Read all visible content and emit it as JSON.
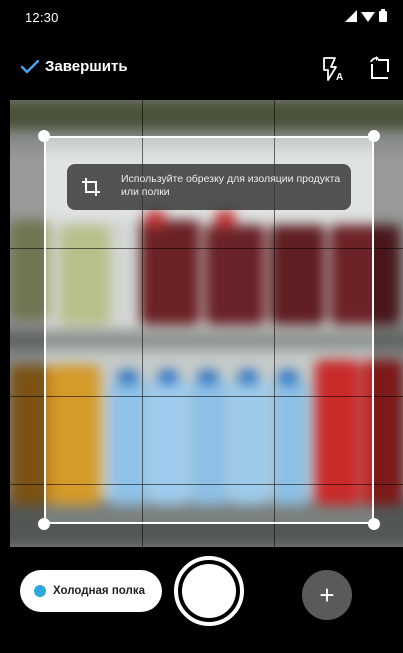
{
  "status_bar": {
    "time": "12:30",
    "icons": [
      "signal-icon",
      "wifi-icon",
      "battery-icon"
    ]
  },
  "toolbar": {
    "done_label": "Завершить",
    "done_icon": "checkmark-icon",
    "flash_icon": "flash-auto-icon",
    "rotate_icon": "rotate-crop-icon",
    "accent": "#4aa3f0"
  },
  "crop": {
    "hint_icon": "crop-icon",
    "hint_text": "Используйте обрезку для изоляции продукта или полки"
  },
  "bottom": {
    "shelf_chip_label": "Холодная полка",
    "shelf_chip_color": "#2fa8e0",
    "shutter_icon": "shutter-button",
    "add_label": "+"
  }
}
